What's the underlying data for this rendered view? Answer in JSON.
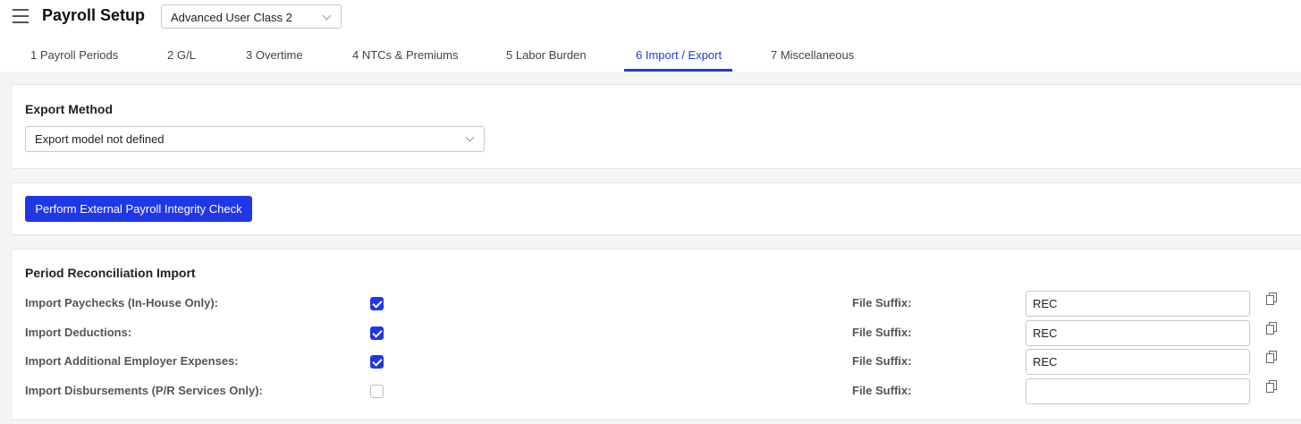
{
  "header": {
    "title": "Payroll Setup",
    "class_selector": {
      "value": "Advanced User Class 2",
      "icon": "chevron-down-icon"
    },
    "menu_icon": "hamburger-menu-icon"
  },
  "tabs": [
    {
      "label": "1 Payroll Periods",
      "active": false
    },
    {
      "label": "2 G/L",
      "active": false
    },
    {
      "label": "3 Overtime",
      "active": false
    },
    {
      "label": "4 NTCs & Premiums",
      "active": false
    },
    {
      "label": "5 Labor Burden",
      "active": false
    },
    {
      "label": "6 Import / Export",
      "active": true
    },
    {
      "label": "7 Miscellaneous",
      "active": false
    }
  ],
  "export_method": {
    "title": "Export Method",
    "select_value": "Export model not defined"
  },
  "integrity_check": {
    "button_label": "Perform External Payroll Integrity Check"
  },
  "reconciliation": {
    "title": "Period Reconciliation Import",
    "suffix_label": "File Suffix:",
    "rows": [
      {
        "label": "Import Paychecks (In-House Only):",
        "checked": true,
        "suffix": "REC"
      },
      {
        "label": "Import Deductions:",
        "checked": true,
        "suffix": "REC"
      },
      {
        "label": "Import Additional Employer Expenses:",
        "checked": true,
        "suffix": "REC"
      },
      {
        "label": "Import Disbursements (P/R Services Only):",
        "checked": false,
        "suffix": ""
      }
    ]
  },
  "colors": {
    "accent": "#2037e8",
    "active_tab": "#1f3dd6"
  }
}
